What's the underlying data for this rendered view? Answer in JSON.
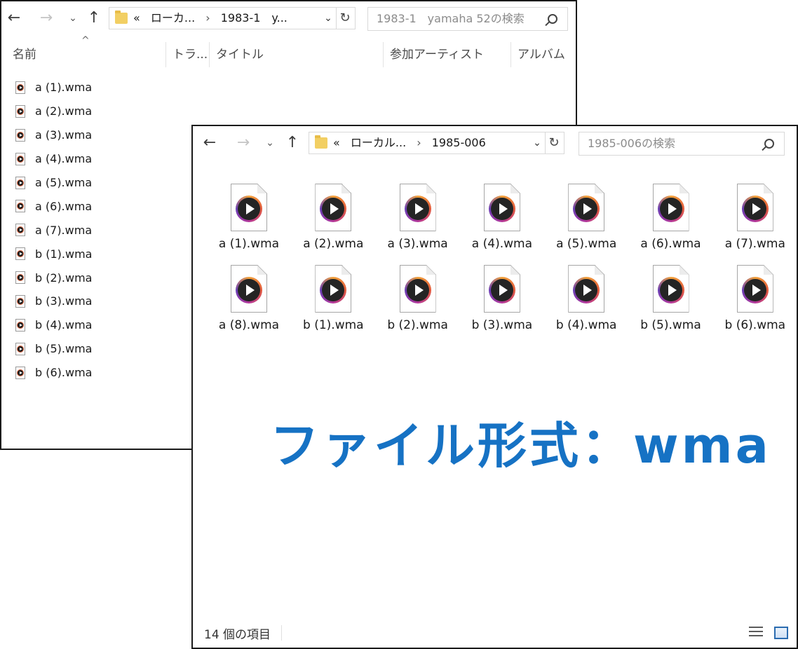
{
  "window_back": {
    "nav": {
      "back": "←",
      "forward": "→",
      "recent": "⌄",
      "up": "↑"
    },
    "address": {
      "chevrons": "«",
      "crumb1": "ローカ...",
      "sep": "›",
      "crumb2": "1983-1　y..."
    },
    "search_placeholder": "1983-1　yamaha 52の検索",
    "columns": [
      "名前",
      "トラ...",
      "タイトル",
      "参加アーティスト",
      "アルバム"
    ],
    "sort_indicator": "^",
    "files": [
      "a (1).wma",
      "a (2).wma",
      "a (3).wma",
      "a (4).wma",
      "a (5).wma",
      "a (6).wma",
      "a (7).wma",
      "b (1).wma",
      "b (2).wma",
      "b (3).wma",
      "b (4).wma",
      "b (5).wma",
      "b (6).wma"
    ]
  },
  "window_front": {
    "nav": {
      "back": "←",
      "forward": "→",
      "recent": "⌄",
      "up": "↑"
    },
    "address": {
      "chevrons": "«",
      "crumb1": "ローカル...",
      "sep": "›",
      "crumb2": "1985-006"
    },
    "search_placeholder": "1985-006の検索",
    "files": [
      "a (1).wma",
      "a (2).wma",
      "a (3).wma",
      "a (4).wma",
      "a (5).wma",
      "a (6).wma",
      "a (7).wma",
      "a (8).wma",
      "b (1).wma",
      "b (2).wma",
      "b (3).wma",
      "b (4).wma",
      "b (5).wma",
      "b (6).wma"
    ],
    "status": "14 個の項目"
  },
  "overlay_text": "ファイル形式：wma",
  "colors": {
    "overlay": "#1672c4",
    "folder": "#f2cf63"
  },
  "icons": [
    "back-arrow-icon",
    "forward-arrow-icon",
    "chevron-down-icon",
    "up-arrow-icon",
    "folder-icon",
    "refresh-icon",
    "search-icon",
    "wma-file-icon",
    "details-view-icon",
    "large-icons-view-icon"
  ]
}
